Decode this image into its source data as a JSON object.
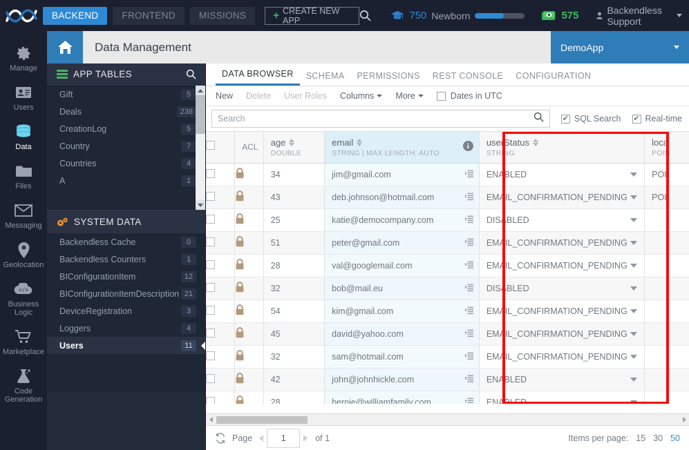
{
  "topbar": {
    "logo_icon": "backendless-logo-icon",
    "nav": [
      {
        "label": "BACKEND",
        "active": true
      },
      {
        "label": "FRONTEND",
        "active": false
      },
      {
        "label": "MISSIONS",
        "active": false
      }
    ],
    "create_app_label": "CREATE NEW APP",
    "create_app_plus": "+",
    "search_icon": "search-icon",
    "graduation_icon": "graduation-cap-icon",
    "points": "750",
    "level_label": "Newborn",
    "progress_percent": 58,
    "money_icon": "money-icon",
    "credits": "575",
    "user_icon": "user-avatar-icon",
    "user_name": "Backendless Support"
  },
  "rail": [
    {
      "label": "Manage",
      "icon": "gear-icon",
      "active": false
    },
    {
      "label": "Users",
      "icon": "users-card-icon",
      "active": false
    },
    {
      "label": "Data",
      "icon": "database-icon",
      "active": true
    },
    {
      "label": "Files",
      "icon": "folder-icon",
      "active": false
    },
    {
      "label": "Messaging",
      "icon": "envelope-icon",
      "active": false
    },
    {
      "label": "Geolocation",
      "icon": "map-pin-icon",
      "active": false
    },
    {
      "label": "Business Logic",
      "icon": "code-cloud-icon",
      "active": false
    },
    {
      "label": "Marketplace",
      "icon": "shopping-cart-icon",
      "active": false
    },
    {
      "label": "Code Generation",
      "icon": "code-generation-icon",
      "active": false
    }
  ],
  "tables_panel": {
    "toolbar": [
      {
        "icon": "plus-icon",
        "name": "add-table-button"
      },
      {
        "icon": "trash-icon",
        "name": "delete-table-button"
      },
      {
        "icon": "gear-icon",
        "name": "table-settings-button"
      },
      {
        "icon": "book-icon",
        "name": "documentation-button"
      },
      {
        "icon": "refresh-icon",
        "name": "refresh-tables-button"
      }
    ],
    "app_tables_title": "APP TABLES",
    "app_tables_icon": "tables-icon",
    "app_tables_search_icon": "search-icon",
    "app_tables": [
      {
        "name": "A",
        "count": "1"
      },
      {
        "name": "Countries",
        "count": "4"
      },
      {
        "name": "Country",
        "count": "7"
      },
      {
        "name": "CreationLog",
        "count": "5"
      },
      {
        "name": "Deals",
        "count": "238"
      },
      {
        "name": "Gift",
        "count": "5"
      }
    ],
    "system_data_title": "SYSTEM DATA",
    "system_data_icon": "gears-icon",
    "system_tables": [
      {
        "name": "Backendless Cache",
        "count": "0",
        "selected": false
      },
      {
        "name": "Backendless Counters",
        "count": "1",
        "selected": false
      },
      {
        "name": "BIConfigurationItem",
        "count": "12",
        "selected": false
      },
      {
        "name": "BIConfigurationItemDescription",
        "count": "21",
        "selected": false
      },
      {
        "name": "DeviceRegistration",
        "count": "3",
        "selected": false
      },
      {
        "name": "Loggers",
        "count": "4",
        "selected": false
      },
      {
        "name": "Users",
        "count": "11",
        "selected": true
      }
    ]
  },
  "page_header": {
    "home_icon": "home-icon",
    "title": "Data Management",
    "app_name": "DemoApp"
  },
  "tabs": [
    {
      "label": "DATA BROWSER",
      "active": true
    },
    {
      "label": "SCHEMA",
      "active": false
    },
    {
      "label": "PERMISSIONS",
      "active": false
    },
    {
      "label": "REST CONSOLE",
      "active": false
    },
    {
      "label": "CONFIGURATION",
      "active": false
    }
  ],
  "actionbar": {
    "new_label": "New",
    "delete_label": "Delete",
    "user_roles_label": "User Roles",
    "columns_label": "Columns",
    "more_label": "More",
    "dates_utc_label": "Dates in UTC",
    "dates_utc_checked": false
  },
  "search": {
    "placeholder": "Search",
    "value": "",
    "search_icon": "search-icon",
    "sql_search_label": "SQL Search",
    "sql_search_checked": true,
    "realtime_label": "Real-time",
    "realtime_checked": true
  },
  "table": {
    "columns": [
      {
        "key": "chk",
        "name": "",
        "type": ""
      },
      {
        "key": "acl",
        "name": "ACL",
        "type": ""
      },
      {
        "key": "age",
        "name": "age",
        "type": "DOUBLE"
      },
      {
        "key": "email",
        "name": "email",
        "type": "STRING | MAX LENGTH: AUTO",
        "highlighted": true
      },
      {
        "key": "userStatus",
        "name": "userStatus",
        "type": "STRING"
      },
      {
        "key": "location",
        "name": "loca",
        "type": "POIN"
      }
    ],
    "rows": [
      {
        "age": "34",
        "email": "jim@gmail.com",
        "userStatus": "ENABLED",
        "location": "POI"
      },
      {
        "age": "43",
        "email": "deb.johnson@hotmail.com",
        "userStatus": "EMAIL_CONFIRMATION_PENDING",
        "location": "POI"
      },
      {
        "age": "25",
        "email": "katie@democompany.com",
        "userStatus": "DISABLED",
        "location": ""
      },
      {
        "age": "51",
        "email": "peter@gmail.com",
        "userStatus": "EMAIL_CONFIRMATION_PENDING",
        "location": ""
      },
      {
        "age": "28",
        "email": "val@googlemail.com",
        "userStatus": "EMAIL_CONFIRMATION_PENDING",
        "location": ""
      },
      {
        "age": "32",
        "email": "bob@mail.eu",
        "userStatus": "DISABLED",
        "location": ""
      },
      {
        "age": "54",
        "email": "kim@gmail.com",
        "userStatus": "EMAIL_CONFIRMATION_PENDING",
        "location": ""
      },
      {
        "age": "45",
        "email": "david@yahoo.com",
        "userStatus": "EMAIL_CONFIRMATION_PENDING",
        "location": ""
      },
      {
        "age": "32",
        "email": "sam@hotmail.com",
        "userStatus": "EMAIL_CONFIRMATION_PENDING",
        "location": ""
      },
      {
        "age": "42",
        "email": "john@johnhickle.com",
        "userStatus": "ENABLED",
        "location": ""
      },
      {
        "age": "28",
        "email": "bernie@williamfamily.com",
        "userStatus": "ENABLED",
        "location": ""
      }
    ],
    "highlight_box_color": "#f40c0c",
    "highlight_column": "userStatus"
  },
  "footer": {
    "refresh_icon": "refresh-icon",
    "page_label": "Page",
    "page_value": "1",
    "of_label": "of 1",
    "items_per_page_label": "Items per page:",
    "items_per_page_options": [
      {
        "label": "15",
        "active": false
      },
      {
        "label": "30",
        "active": false
      },
      {
        "label": "50",
        "active": true
      }
    ]
  },
  "colors": {
    "accent_blue": "#2e8ad5",
    "header_blue": "#2e7cb8",
    "dark_navy": "#1a2030",
    "panel_navy": "#1f2635",
    "green": "#41b95f",
    "highlight_red": "#f40c0c",
    "email_col_tint": "#ddf0f8"
  }
}
